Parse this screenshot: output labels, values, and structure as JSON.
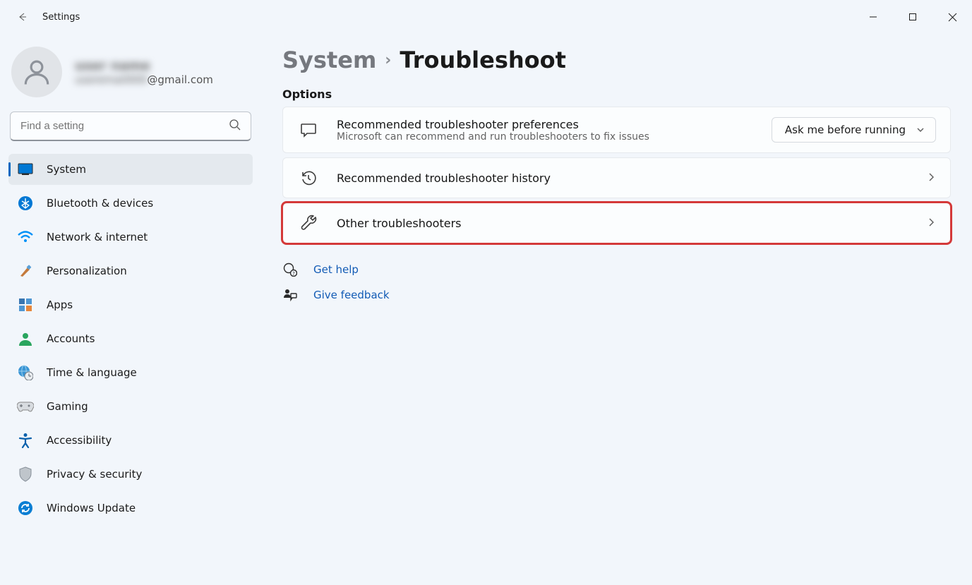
{
  "window": {
    "title": "Settings"
  },
  "profile": {
    "name_blurred": "—",
    "email_blurred_prefix": "—",
    "email_suffix": "@gmail.com"
  },
  "search": {
    "placeholder": "Find a setting"
  },
  "nav": [
    {
      "id": "system",
      "label": "System",
      "selected": true
    },
    {
      "id": "bluetooth",
      "label": "Bluetooth & devices",
      "selected": false
    },
    {
      "id": "network",
      "label": "Network & internet",
      "selected": false
    },
    {
      "id": "personalization",
      "label": "Personalization",
      "selected": false
    },
    {
      "id": "apps",
      "label": "Apps",
      "selected": false
    },
    {
      "id": "accounts",
      "label": "Accounts",
      "selected": false
    },
    {
      "id": "time",
      "label": "Time & language",
      "selected": false
    },
    {
      "id": "gaming",
      "label": "Gaming",
      "selected": false
    },
    {
      "id": "accessibility",
      "label": "Accessibility",
      "selected": false
    },
    {
      "id": "privacy",
      "label": "Privacy & security",
      "selected": false
    },
    {
      "id": "update",
      "label": "Windows Update",
      "selected": false
    }
  ],
  "breadcrumb": {
    "parent": "System",
    "current": "Troubleshoot"
  },
  "section_label": "Options",
  "cards": {
    "prefs": {
      "title": "Recommended troubleshooter preferences",
      "subtitle": "Microsoft can recommend and run troubleshooters to fix issues",
      "dropdown_value": "Ask me before running"
    },
    "history": {
      "title": "Recommended troubleshooter history"
    },
    "other": {
      "title": "Other troubleshooters"
    }
  },
  "links": {
    "help": "Get help",
    "feedback": "Give feedback"
  }
}
